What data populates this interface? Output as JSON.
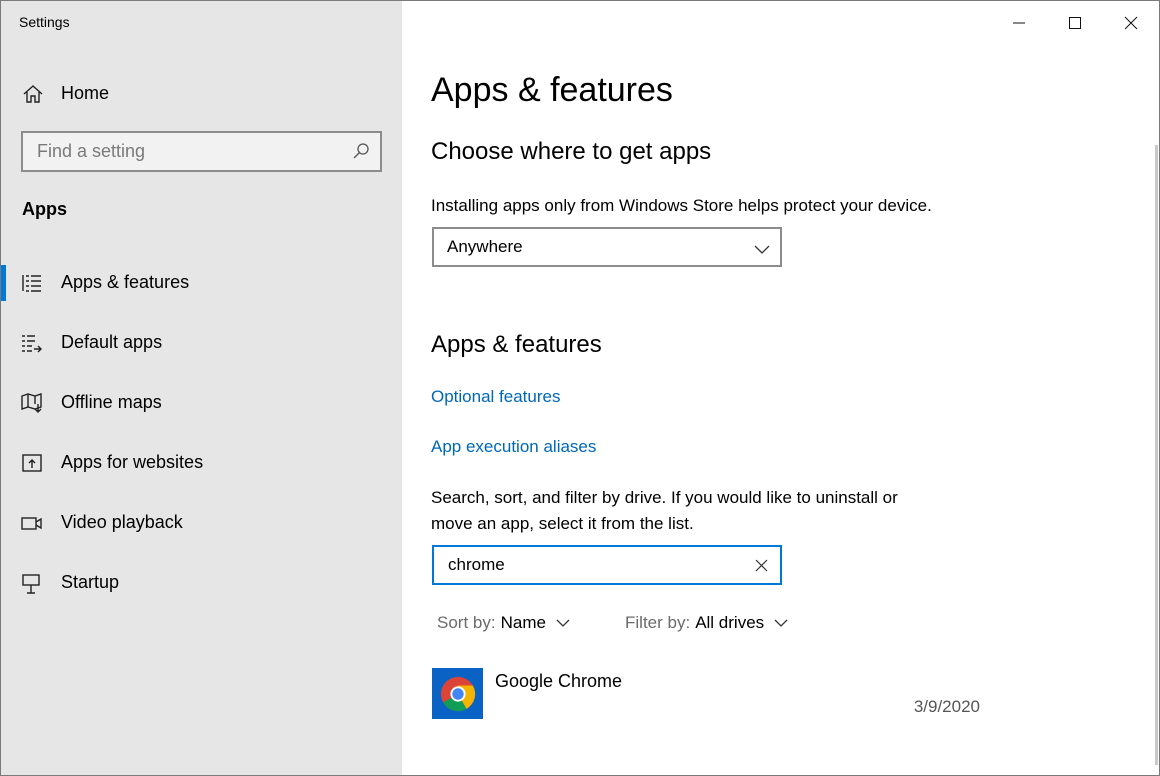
{
  "window": {
    "title": "Settings"
  },
  "sidebar": {
    "home_label": "Home",
    "search_placeholder": "Find a setting",
    "section_label": "Apps",
    "items": [
      {
        "label": "Apps & features",
        "icon": "list-icon",
        "active": true
      },
      {
        "label": "Default apps",
        "icon": "default-apps-icon",
        "active": false
      },
      {
        "label": "Offline maps",
        "icon": "map-icon",
        "active": false
      },
      {
        "label": "Apps for websites",
        "icon": "open-in-window-icon",
        "active": false
      },
      {
        "label": "Video playback",
        "icon": "video-camera-icon",
        "active": false
      },
      {
        "label": "Startup",
        "icon": "startup-icon",
        "active": false
      }
    ]
  },
  "main": {
    "title": "Apps & features",
    "choose_heading": "Choose where to get apps",
    "choose_desc": "Installing apps only from Windows Store helps protect your device.",
    "source_dropdown_value": "Anywhere",
    "apps_heading": "Apps & features",
    "optional_features_link": "Optional features",
    "execution_aliases_link": "App execution aliases",
    "search_desc_line1": "Search, sort, and filter by drive. If you would like to uninstall or",
    "search_desc_line2": "move an app, select it from the list.",
    "search_value": "chrome",
    "sort_key": "Sort by:",
    "sort_value": "Name",
    "filter_key": "Filter by:",
    "filter_value": "All drives",
    "apps": [
      {
        "name": "Google Chrome",
        "date": "3/9/2020",
        "icon": "chrome-icon"
      }
    ]
  },
  "colors": {
    "accent": "#0078d7",
    "link": "#0067b8",
    "sidebar_bg": "#e6e6e6"
  }
}
